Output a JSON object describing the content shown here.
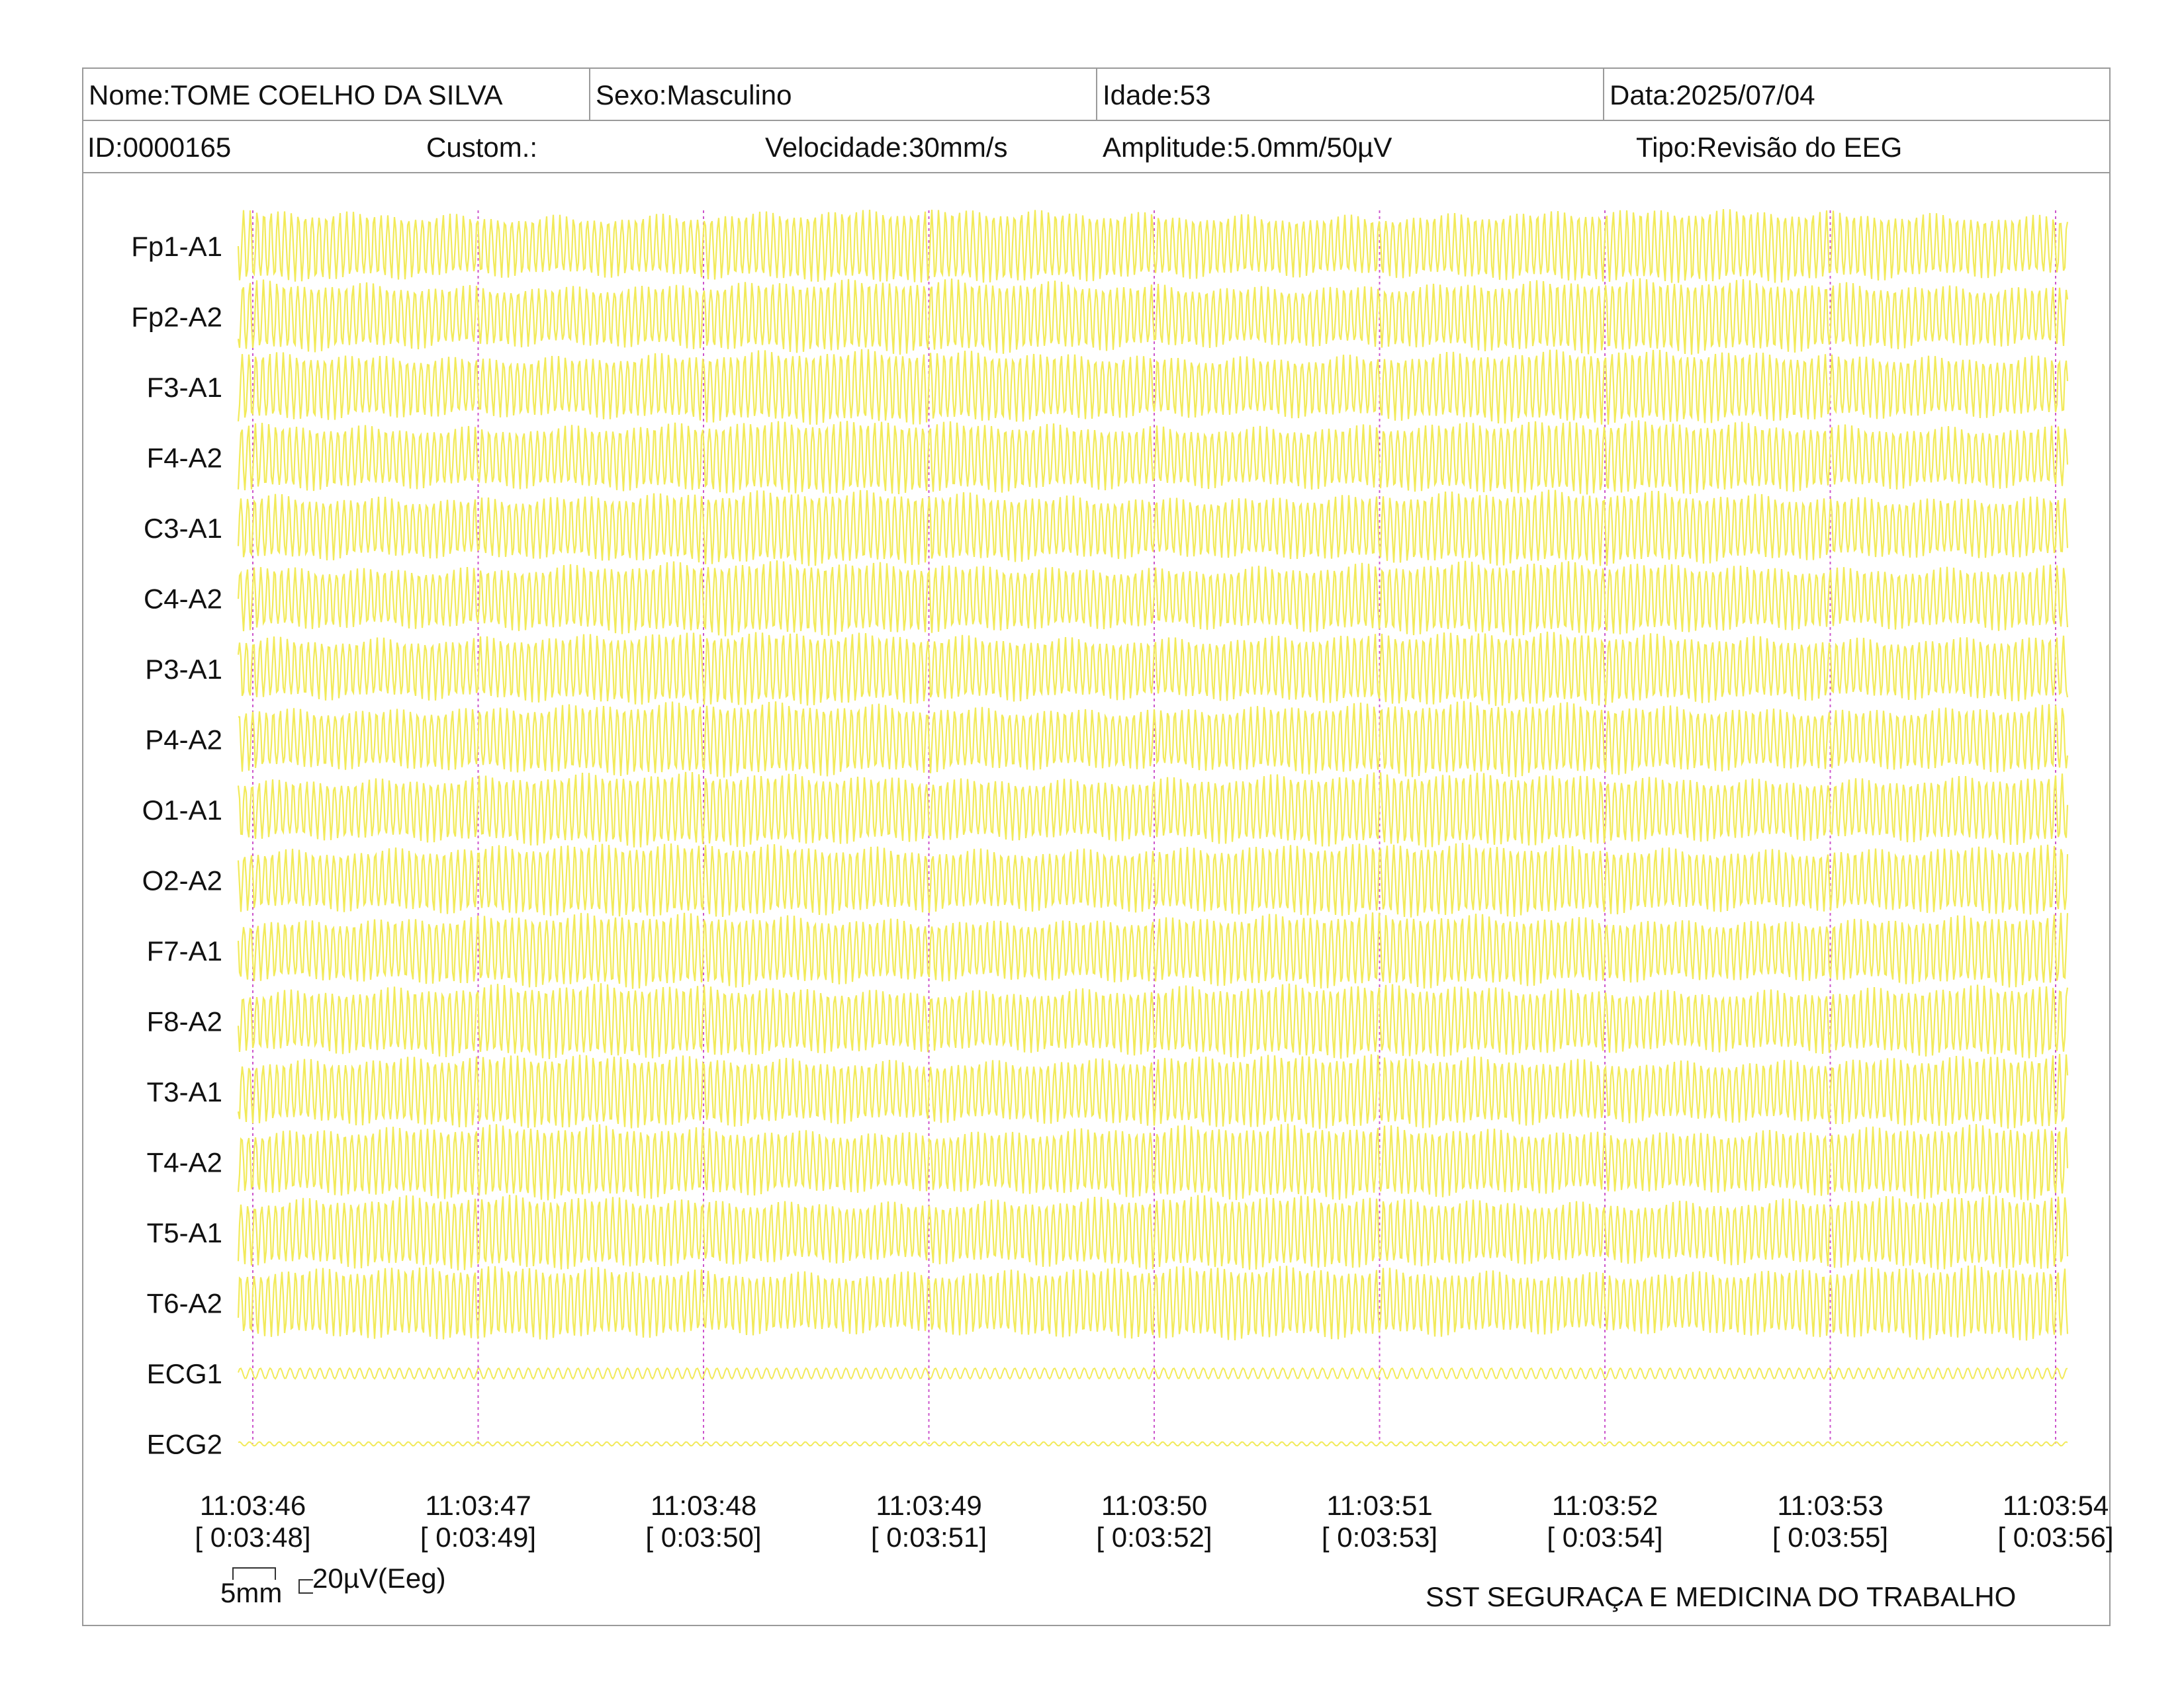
{
  "header": {
    "nome": "Nome:TOME COELHO DA SILVA",
    "sexo": "Sexo:Masculino",
    "idade": "Idade:53",
    "data": "Data:2025/07/04",
    "id": "ID:0000165",
    "custom": "Custom.:",
    "velocidade": "Velocidade:30mm/s",
    "amplitude": "Amplitude:5.0mm/50µV",
    "tipo": "Tipo:Revisão do EEG"
  },
  "colors": {
    "trace": "#f2ea5a",
    "marker": "#cc55cc",
    "border": "#9a9a9a"
  },
  "chart_data": {
    "type": "line",
    "series": [
      {
        "name": "Fp1-A1"
      },
      {
        "name": "Fp2-A2"
      },
      {
        "name": "F3-A1"
      },
      {
        "name": "F4-A2"
      },
      {
        "name": "C3-A1"
      },
      {
        "name": "C4-A2"
      },
      {
        "name": "P3-A1"
      },
      {
        "name": "P4-A2"
      },
      {
        "name": "O1-A1"
      },
      {
        "name": "O2-A2"
      },
      {
        "name": "F7-A1"
      },
      {
        "name": "F8-A2"
      },
      {
        "name": "T3-A1"
      },
      {
        "name": "T4-A2"
      },
      {
        "name": "T5-A1"
      },
      {
        "name": "T6-A2"
      },
      {
        "name": "ECG1"
      },
      {
        "name": "ECG2"
      }
    ],
    "time_ticks": [
      {
        "clock": "11:03:46",
        "elapsed": "[ 0:03:48]"
      },
      {
        "clock": "11:03:47",
        "elapsed": "[ 0:03:49]"
      },
      {
        "clock": "11:03:48",
        "elapsed": "[ 0:03:50]"
      },
      {
        "clock": "11:03:49",
        "elapsed": "[ 0:03:51]"
      },
      {
        "clock": "11:03:50",
        "elapsed": "[ 0:03:52]"
      },
      {
        "clock": "11:03:51",
        "elapsed": "[ 0:03:53]"
      },
      {
        "clock": "11:03:52",
        "elapsed": "[ 0:03:54]"
      },
      {
        "clock": "11:03:53",
        "elapsed": "[ 0:03:55]"
      },
      {
        "clock": "11:03:54",
        "elapsed": "[ 0:03:56]"
      }
    ],
    "grid": false
  },
  "footer": {
    "scale_time": "5mm",
    "scale_amp": "20µV(Eeg)",
    "company": "SST SEGURAÇA E MEDICINA DO TRABALHO"
  }
}
